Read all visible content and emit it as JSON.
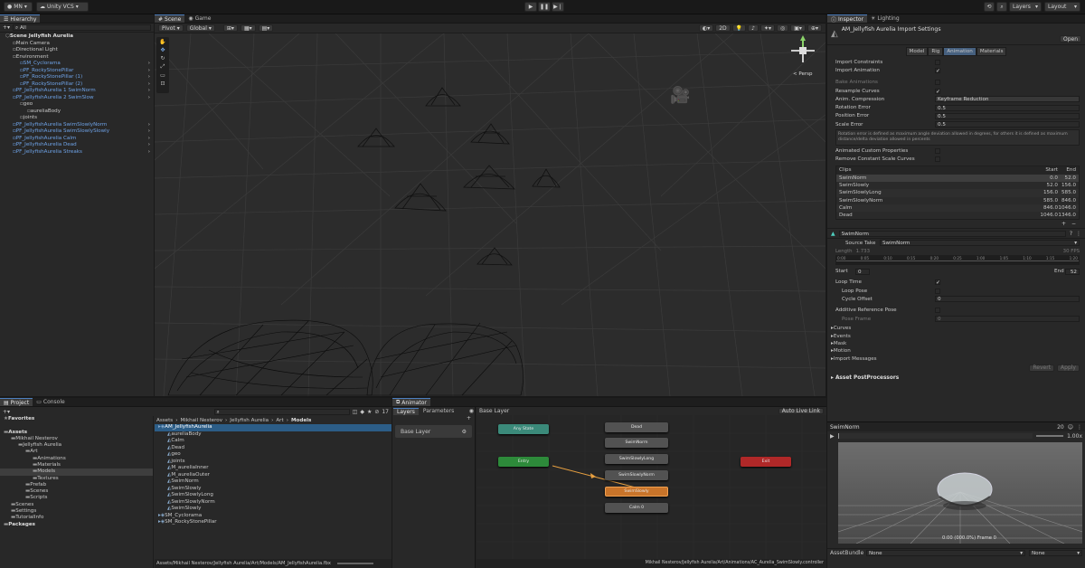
{
  "toolbar": {
    "account": "MN",
    "vcs": "Unity VCS",
    "layers": "Layers",
    "layout": "Layout"
  },
  "hierarchy": {
    "tab": "Hierarchy",
    "search": "All",
    "items": [
      {
        "label": "Scene Jellyfish Aurelia",
        "lvl": 0,
        "style": "bold"
      },
      {
        "label": "Main Camera",
        "lvl": 1
      },
      {
        "label": "Directional Light",
        "lvl": 1
      },
      {
        "label": "Environment",
        "lvl": 1
      },
      {
        "label": "SM_Cyclorama",
        "lvl": 2,
        "style": "blue"
      },
      {
        "label": "PF_RockyStonePillar",
        "lvl": 2,
        "style": "blue"
      },
      {
        "label": "PF_RockyStonePillar (1)",
        "lvl": 2,
        "style": "blue"
      },
      {
        "label": "PF_RockyStonePillar (2)",
        "lvl": 2,
        "style": "blue"
      },
      {
        "label": "PF_JellyfishAurelia 1 SwimNorm",
        "lvl": 1,
        "style": "blue"
      },
      {
        "label": "PF_JellyfishAurelia 2 SwimSlow",
        "lvl": 1,
        "style": "blue"
      },
      {
        "label": "geo",
        "lvl": 2
      },
      {
        "label": "aureliaBody",
        "lvl": 3
      },
      {
        "label": "joints",
        "lvl": 2
      },
      {
        "label": "PF_JellyfishAurelia SwimSlowlyNorm",
        "lvl": 1,
        "style": "blue"
      },
      {
        "label": "PF_JellyfishAurelia SwimSlowlySlowly",
        "lvl": 1,
        "style": "blue"
      },
      {
        "label": "PF_JellyfishAurelia Calm",
        "lvl": 1,
        "style": "blue"
      },
      {
        "label": "PF_JellyfishAurelia Dead",
        "lvl": 1,
        "style": "blue"
      },
      {
        "label": "PF_JellyfishAurelia Streaks",
        "lvl": 1,
        "style": "blue"
      }
    ]
  },
  "scene": {
    "tab_scene": "Scene",
    "tab_game": "Game",
    "pivot": "Pivot",
    "global": "Global",
    "persp": "< Persp",
    "mode_2d": "2D"
  },
  "inspector": {
    "tab_inspector": "Inspector",
    "tab_lighting": "Lighting",
    "title": "AM_Jellyfish Aurelia Import Settings",
    "open": "Open",
    "tabs": [
      "Model",
      "Rig",
      "Animation",
      "Materials"
    ],
    "rows": [
      {
        "label": "Import Constraints",
        "type": "check",
        "value": ""
      },
      {
        "label": "Import Animation",
        "type": "check",
        "value": "✓"
      },
      {
        "label": "",
        "type": "space"
      },
      {
        "label": "Bake Animations",
        "type": "check",
        "value": "",
        "dim": true
      },
      {
        "label": "Resample Curves",
        "type": "check",
        "value": "✓"
      },
      {
        "label": "Anim. Compression",
        "type": "select",
        "value": "Keyframe Reduction"
      },
      {
        "label": "Rotation Error",
        "type": "field",
        "value": "0.5"
      },
      {
        "label": "Position Error",
        "type": "field",
        "value": "0.5"
      },
      {
        "label": "Scale Error",
        "type": "field",
        "value": "0.5"
      }
    ],
    "help": "Rotation error is defined as maximum angle deviation allowed in degrees, for others it is defined as maximum distance/delta deviation allowed in percents",
    "rows2": [
      {
        "label": "Animated Custom Properties",
        "value": ""
      },
      {
        "label": "Remove Constant Scale Curves",
        "value": ""
      }
    ],
    "clips_header": {
      "name": "Clips",
      "start": "Start",
      "end": "End"
    },
    "clips": [
      {
        "name": "SwimNorm",
        "start": "0.0",
        "end": "52.0"
      },
      {
        "name": "SwimSlowly",
        "start": "52.0",
        "end": "156.0"
      },
      {
        "name": "SwimSlowlyLong",
        "start": "156.0",
        "end": "585.0"
      },
      {
        "name": "SwimSlowlyNorm",
        "start": "585.0",
        "end": "846.0"
      },
      {
        "name": "Calm",
        "start": "846.0",
        "end": "1046.0"
      },
      {
        "name": "Dead",
        "start": "1046.0",
        "end": "1346.0"
      }
    ],
    "clip": {
      "name": "SwimNorm",
      "source_take_label": "Source Take",
      "source_take": "SwimNorm",
      "length_label": "Length",
      "length": "1.733",
      "fps": "30 FPS",
      "ticks": [
        "0:00",
        "0:05",
        "0:10",
        "0:15",
        "0:20",
        "0:25",
        "1:00",
        "1:05",
        "1:10",
        "1:15",
        "1:20"
      ],
      "start_label": "Start",
      "start": "0",
      "end_label": "End",
      "end": "52",
      "loop_time": "Loop Time",
      "loop_pose": "Loop Pose",
      "cycle_offset": "Cycle Offset",
      "cycle_offset_val": "0",
      "additive": "Additive Reference Pose",
      "pose_frame": "Pose Frame",
      "pose_frame_val": "0"
    },
    "foldouts": [
      "Curves",
      "Events",
      "Mask",
      "Motion",
      "Import Messages"
    ],
    "revert": "Revert",
    "apply": "Apply",
    "postprocessors": "Asset PostProcessors",
    "preview": {
      "title": "SwimNorm",
      "speed": "1.00x",
      "timecode": "0:00 (000.0%) Frame 0",
      "fps_num": "20"
    },
    "assetbundle": {
      "label": "AssetBundle",
      "value": "None",
      "variant": "None"
    }
  },
  "project": {
    "tab_project": "Project",
    "tab_console": "Console",
    "count": "17",
    "tree": [
      {
        "label": "Favorites",
        "lvl": 0,
        "bold": true
      },
      {
        "label": "",
        "lvl": 0
      },
      {
        "label": "Assets",
        "lvl": 0,
        "bold": true
      },
      {
        "label": "Mikhail Nesterov",
        "lvl": 1
      },
      {
        "label": "Jellyfish Aurelia",
        "lvl": 2
      },
      {
        "label": "Art",
        "lvl": 3
      },
      {
        "label": "Animations",
        "lvl": 4
      },
      {
        "label": "Materials",
        "lvl": 4
      },
      {
        "label": "Models",
        "lvl": 4,
        "sel": true
      },
      {
        "label": "Textures",
        "lvl": 4
      },
      {
        "label": "Prefab",
        "lvl": 3
      },
      {
        "label": "Scenes",
        "lvl": 3
      },
      {
        "label": "Scripts",
        "lvl": 3
      },
      {
        "label": "Scenes",
        "lvl": 1
      },
      {
        "label": "Settings",
        "lvl": 1
      },
      {
        "label": "TutorialInfo",
        "lvl": 1
      },
      {
        "label": "Packages",
        "lvl": 0,
        "bold": true
      }
    ],
    "breadcrumb": [
      "Assets",
      "Mikhail Nesterov",
      "Jellyfish Aurelia",
      "Art",
      "Models"
    ],
    "files": [
      {
        "label": "AM_JellyfishAurelia",
        "lvl": 0,
        "sel": true
      },
      {
        "label": "aureliaBody",
        "lvl": 1
      },
      {
        "label": "Calm",
        "lvl": 1
      },
      {
        "label": "Dead",
        "lvl": 1
      },
      {
        "label": "geo",
        "lvl": 1
      },
      {
        "label": "joints",
        "lvl": 1
      },
      {
        "label": "M_aureliaInner",
        "lvl": 1
      },
      {
        "label": "M_aureliaOuter",
        "lvl": 1
      },
      {
        "label": "SwimNorm",
        "lvl": 1
      },
      {
        "label": "SwimSlowly",
        "lvl": 1
      },
      {
        "label": "SwimSlowlyLong",
        "lvl": 1
      },
      {
        "label": "SwimSlowlyNorm",
        "lvl": 1
      },
      {
        "label": "SwimSlowly",
        "lvl": 1
      },
      {
        "label": "SM_Cyclorama",
        "lvl": 0
      },
      {
        "label": "SM_RockyStonePillar",
        "lvl": 0
      }
    ],
    "status_path": "Assets/Mikhail Nesterov/Jellyfish Aurelia/Art/Models/AM_JellyfishAurelia.fbx"
  },
  "animator": {
    "tab": "Animator",
    "tab_layers": "Layers",
    "tab_params": "Parameters",
    "base_layer": "Base Layer",
    "breadcrumb": "Base Layer",
    "auto_live": "Auto Live Link",
    "nodes": {
      "any": "Any State",
      "entry": "Entry",
      "exit": "Exit",
      "dead": "Dead",
      "swimnorm": "SwimNorm",
      "swimslowlylong": "SwimSlowlyLong",
      "swimslowlynorm": "SwimSlowlyNorm",
      "swimslowly": "SwimSlowly",
      "calm": "Calm 0"
    },
    "status": "Mikhail Nesterov/Jellyfish Aurelia/Art/Animations/AC_Aurelia_SwimSlowly.controller"
  },
  "colors": {
    "accent": "#4d7fbf",
    "default_state": "#c8742a",
    "entry": "#2d8a3a",
    "any": "#3b8a7a",
    "exit": "#b02828",
    "state": "#525252"
  }
}
